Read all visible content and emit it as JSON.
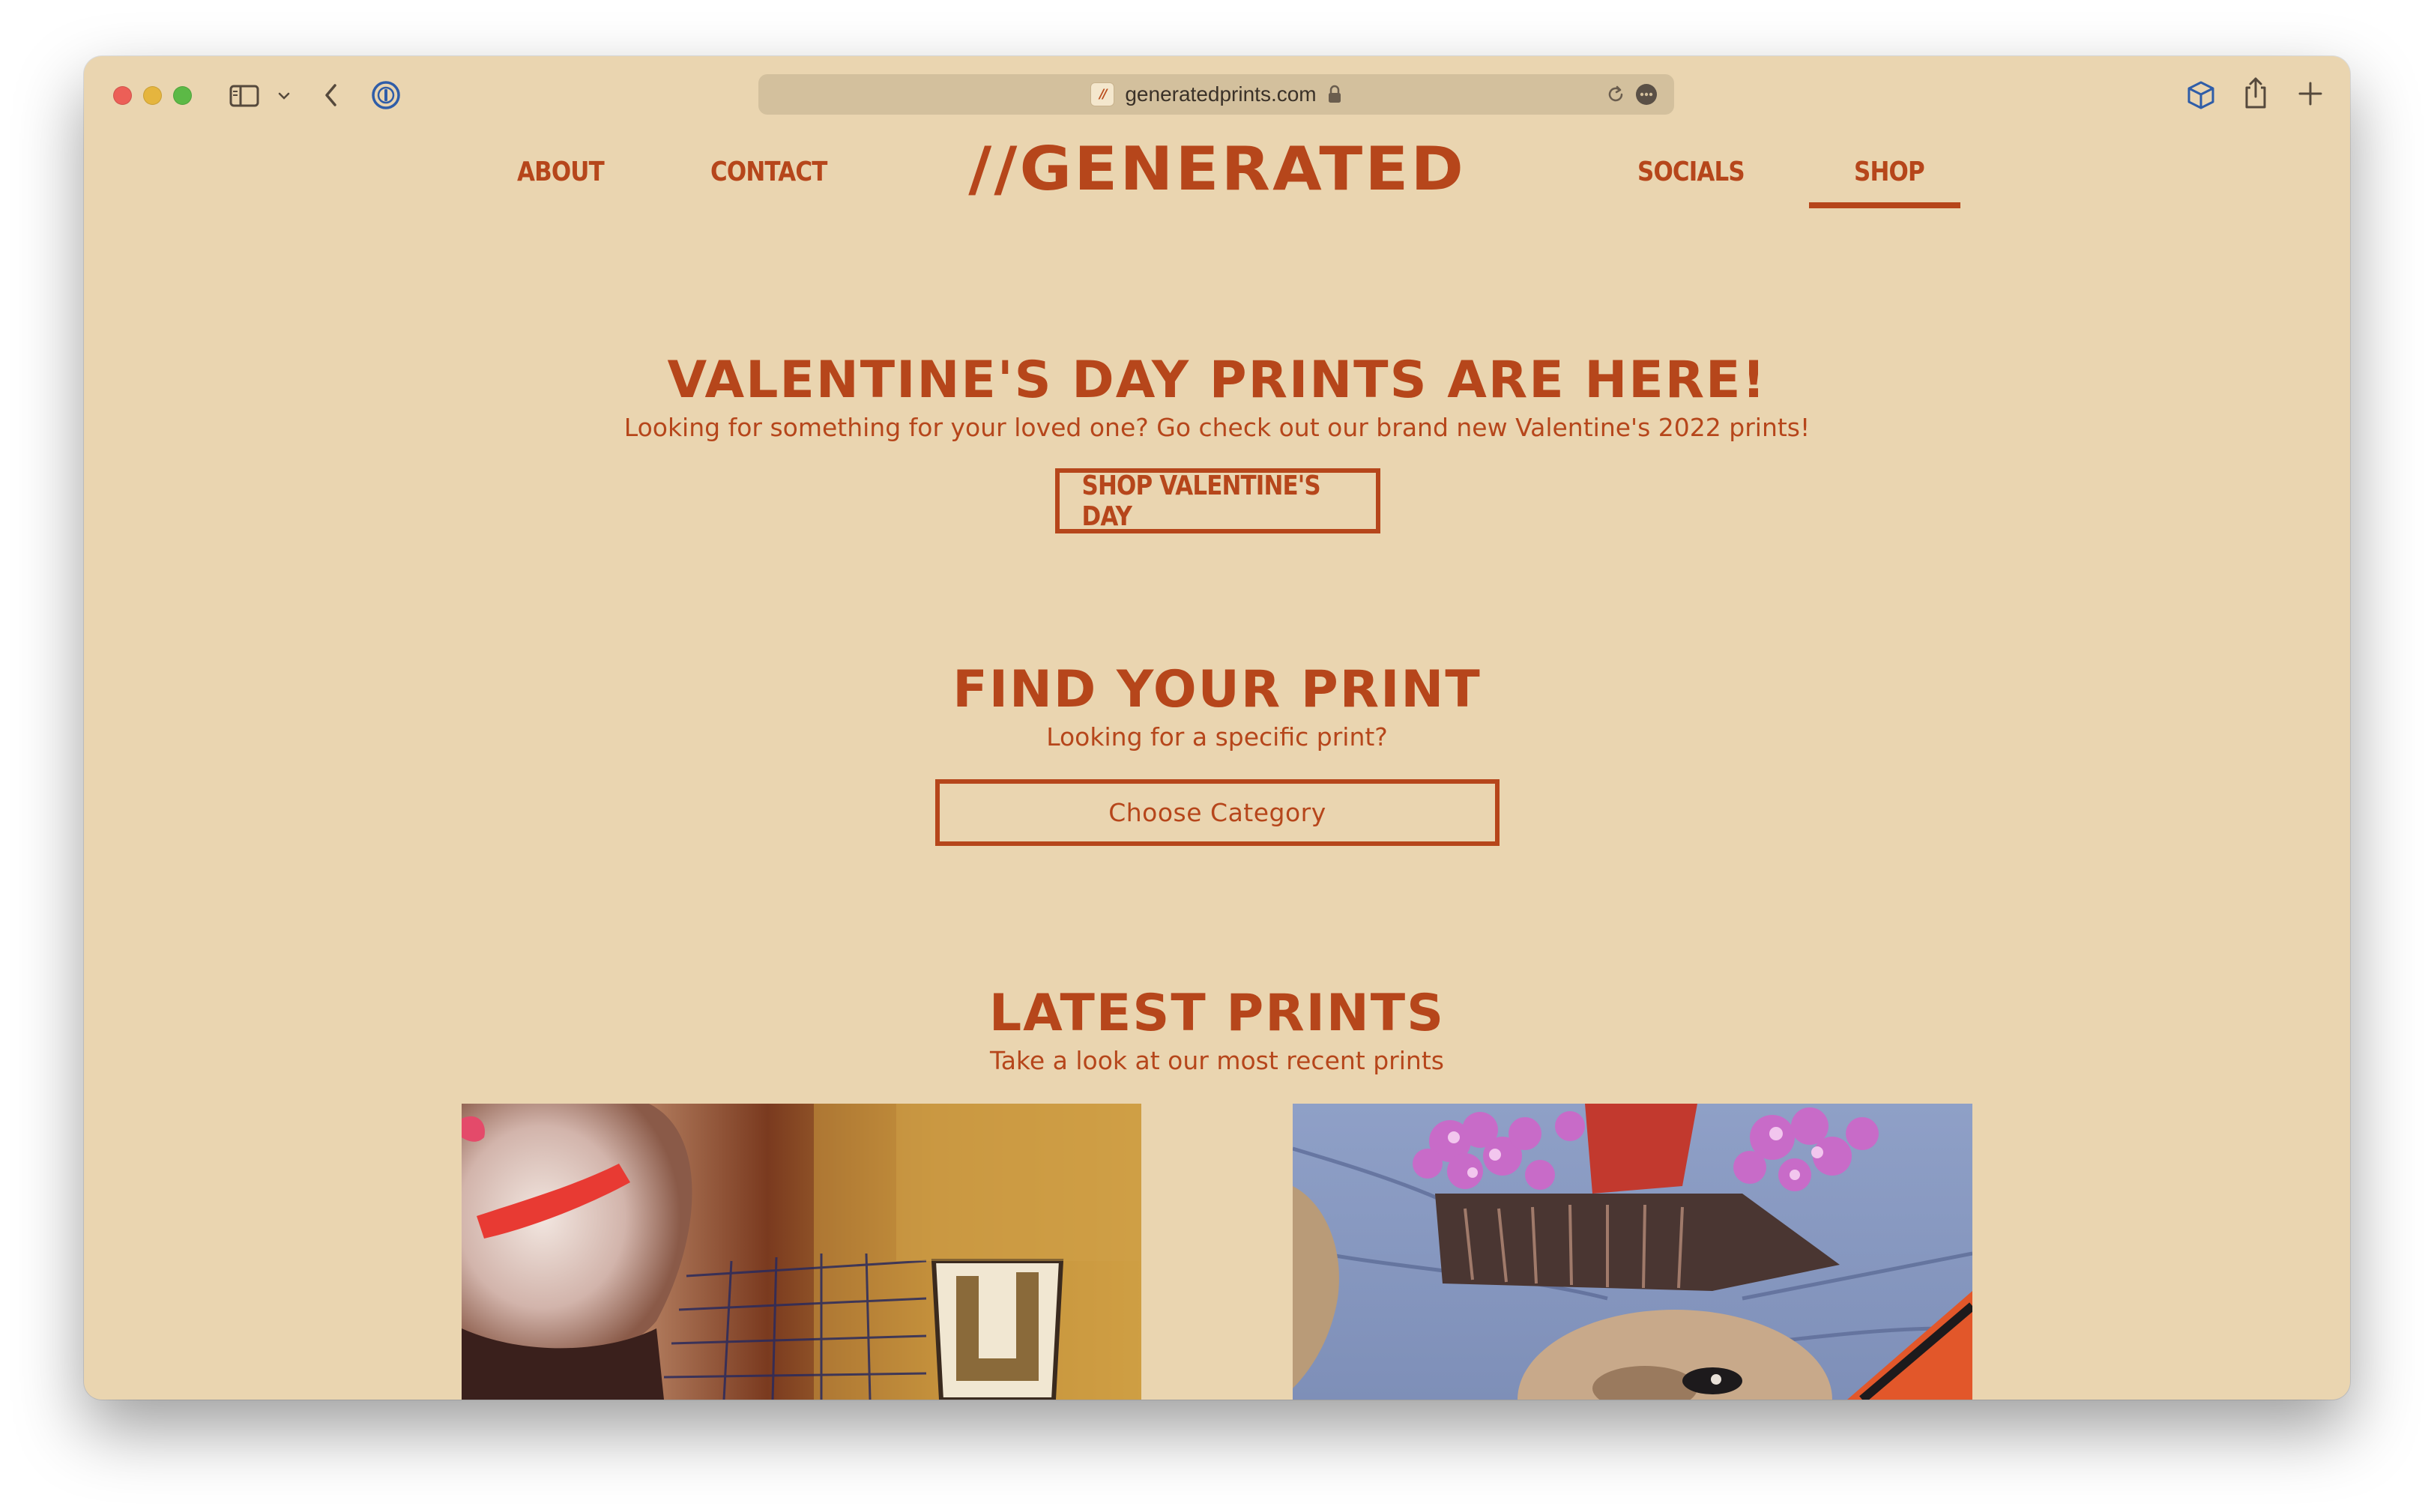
{
  "browser": {
    "url": "generatedprints.com",
    "favicon_text": "//"
  },
  "nav": {
    "about": "ABOUT",
    "contact": "CONTACT",
    "logo": "//GENERATED",
    "socials": "SOCIALS",
    "shop": "SHOP",
    "active_item": "SHOP"
  },
  "valentine": {
    "heading": "VALENTINE'S DAY PRINTS ARE HERE!",
    "text": "Looking for something for your loved one? Go check out our brand new Valentine's 2022 prints!",
    "button": "SHOP VALENTINE'S DAY"
  },
  "find": {
    "heading": "FIND YOUR PRINT",
    "text": "Looking for a specific print?",
    "select_value": "Choose Category"
  },
  "latest": {
    "heading": "LATEST PRINTS",
    "text": "Take a look at our most recent prints"
  },
  "colors": {
    "background": "#ead5b0",
    "accent": "#b6461b"
  },
  "icons": {
    "toolbar": [
      "sidebar-icon",
      "chevron-down-icon",
      "back-icon",
      "password-manager-icon",
      "lock-icon",
      "reload-icon",
      "more-icon",
      "cube-icon",
      "share-icon",
      "plus-icon"
    ]
  }
}
